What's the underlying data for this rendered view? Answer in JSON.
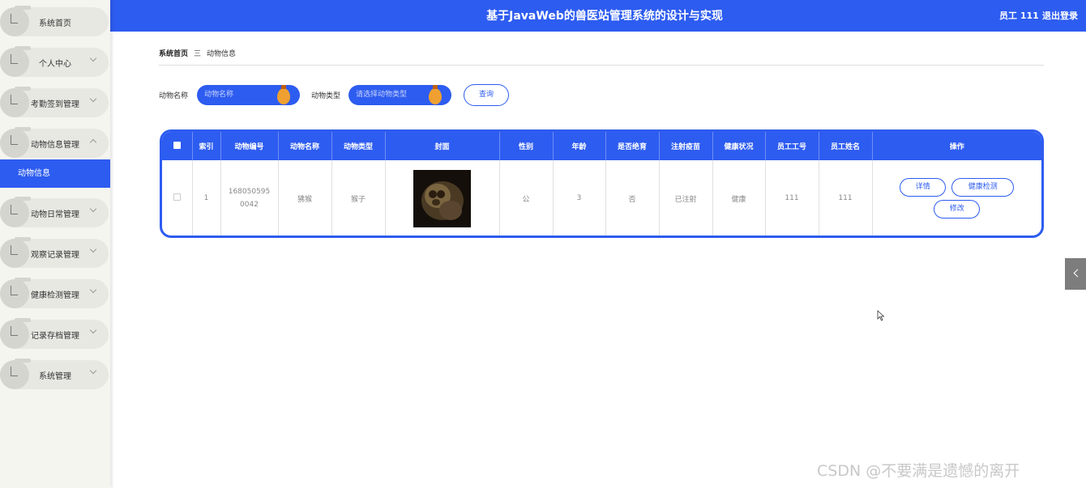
{
  "header": {
    "title": "基于JavaWeb的兽医站管理系统的设计与实现",
    "user_label": "员工 111",
    "logout_label": "退出登录"
  },
  "sidebar": {
    "items": [
      {
        "label": "系统首页"
      },
      {
        "label": "个人中心"
      },
      {
        "label": "考勤签到管理"
      },
      {
        "label": "动物信息管理"
      },
      {
        "label": "动物日常管理"
      },
      {
        "label": "观察记录管理"
      },
      {
        "label": "健康检测管理"
      },
      {
        "label": "记录存档管理"
      },
      {
        "label": "系统管理"
      }
    ],
    "active_sub": "动物信息"
  },
  "breadcrumb": {
    "home": "系统首页",
    "separator": "三",
    "current": "动物信息"
  },
  "search": {
    "name_label": "动物名称",
    "name_placeholder": "动物名称",
    "type_label": "动物类型",
    "type_placeholder": "请选择动物类型",
    "query_label": "查询"
  },
  "table": {
    "headers": [
      "索引",
      "动物编号",
      "动物名称",
      "动物类型",
      "封面",
      "性别",
      "年龄",
      "是否绝育",
      "注射疫苗",
      "健康状况",
      "员工工号",
      "员工姓名",
      "操作"
    ],
    "rows": [
      {
        "index": "1",
        "animal_no": "1680505950042",
        "name": "狒猴",
        "type": "猴子",
        "gender": "公",
        "age": "3",
        "neutered": "否",
        "vaccine": "已注射",
        "health": "健康",
        "staff_no": "111",
        "staff_name": "111",
        "actions": {
          "detail": "详情",
          "health_check": "健康检测",
          "edit": "修改"
        }
      }
    ]
  },
  "watermark": "CSDN @不要满是遗憾的离开",
  "colors": {
    "primary": "#2d5cf0",
    "knob": "#f0a030"
  }
}
